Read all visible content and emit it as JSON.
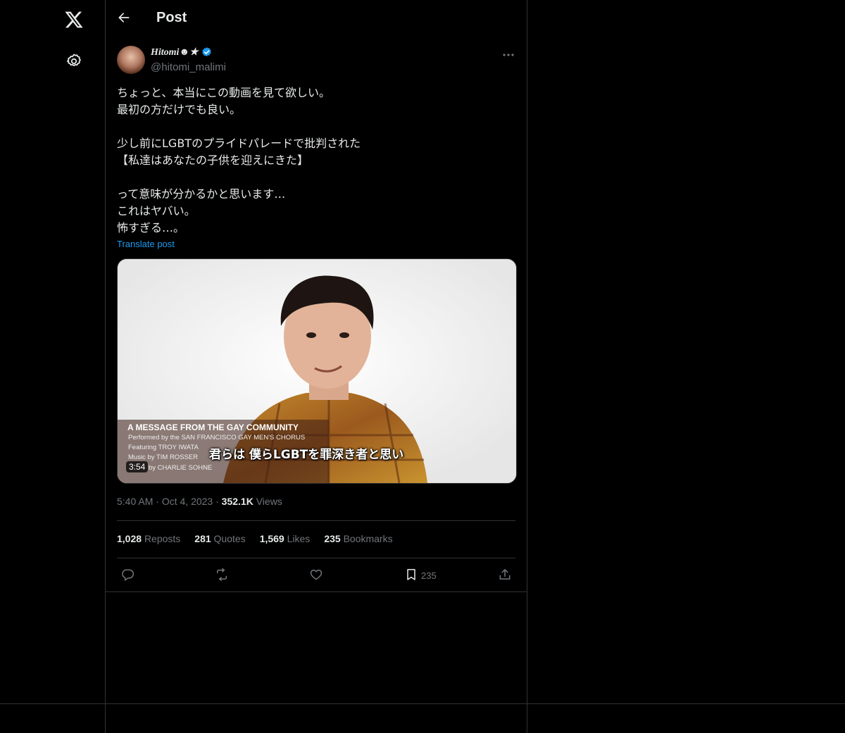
{
  "header": {
    "title": "Post"
  },
  "post": {
    "author": {
      "name": "Hitomi☻★",
      "handle": "@hitomi_malimi"
    },
    "text": "ちょっと、本当にこの動画を見て欲しい。\n最初の方だけでも良い。\n\n少し前にLGBTのプライドパレードで批判された\n【私達はあなたの子供を迎えにきた】\n\nって意味が分かるかと思います…\nこれはヤバい。\n怖すぎる…。",
    "translate_label": "Translate post",
    "video": {
      "overlay_title": "A MESSAGE FROM THE GAY COMMUNITY",
      "overlay_lines": [
        "Performed by the SAN FRANCISCO GAY MEN'S CHORUS",
        "Featuring TROY IWATA",
        "Music by TIM ROSSER",
        "by CHARLIE SOHNE"
      ],
      "subtitle": "君らは 僕らLGBTを罪深き者と思い",
      "duration": "3:54"
    },
    "time": "5:40 AM",
    "date": "Oct 4, 2023",
    "views_count": "352.1K",
    "views_label": "Views",
    "stats": [
      {
        "count": "1,028",
        "label": "Reposts"
      },
      {
        "count": "281",
        "label": "Quotes"
      },
      {
        "count": "1,569",
        "label": "Likes"
      },
      {
        "count": "235",
        "label": "Bookmarks"
      }
    ],
    "actions": {
      "bookmark_count": "235"
    }
  },
  "icons": {
    "logo": "x-logo-icon",
    "settings": "gear-icon",
    "back": "arrow-left-icon",
    "more": "more-horizontal-icon",
    "reply": "reply-icon",
    "repost": "repost-icon",
    "like": "heart-icon",
    "bookmark": "bookmark-icon",
    "share": "share-icon"
  },
  "colors": {
    "background": "#000000",
    "text": "#e7e9ea",
    "muted": "#71767b",
    "accent": "#1d9bf0",
    "border": "#2f3336"
  }
}
